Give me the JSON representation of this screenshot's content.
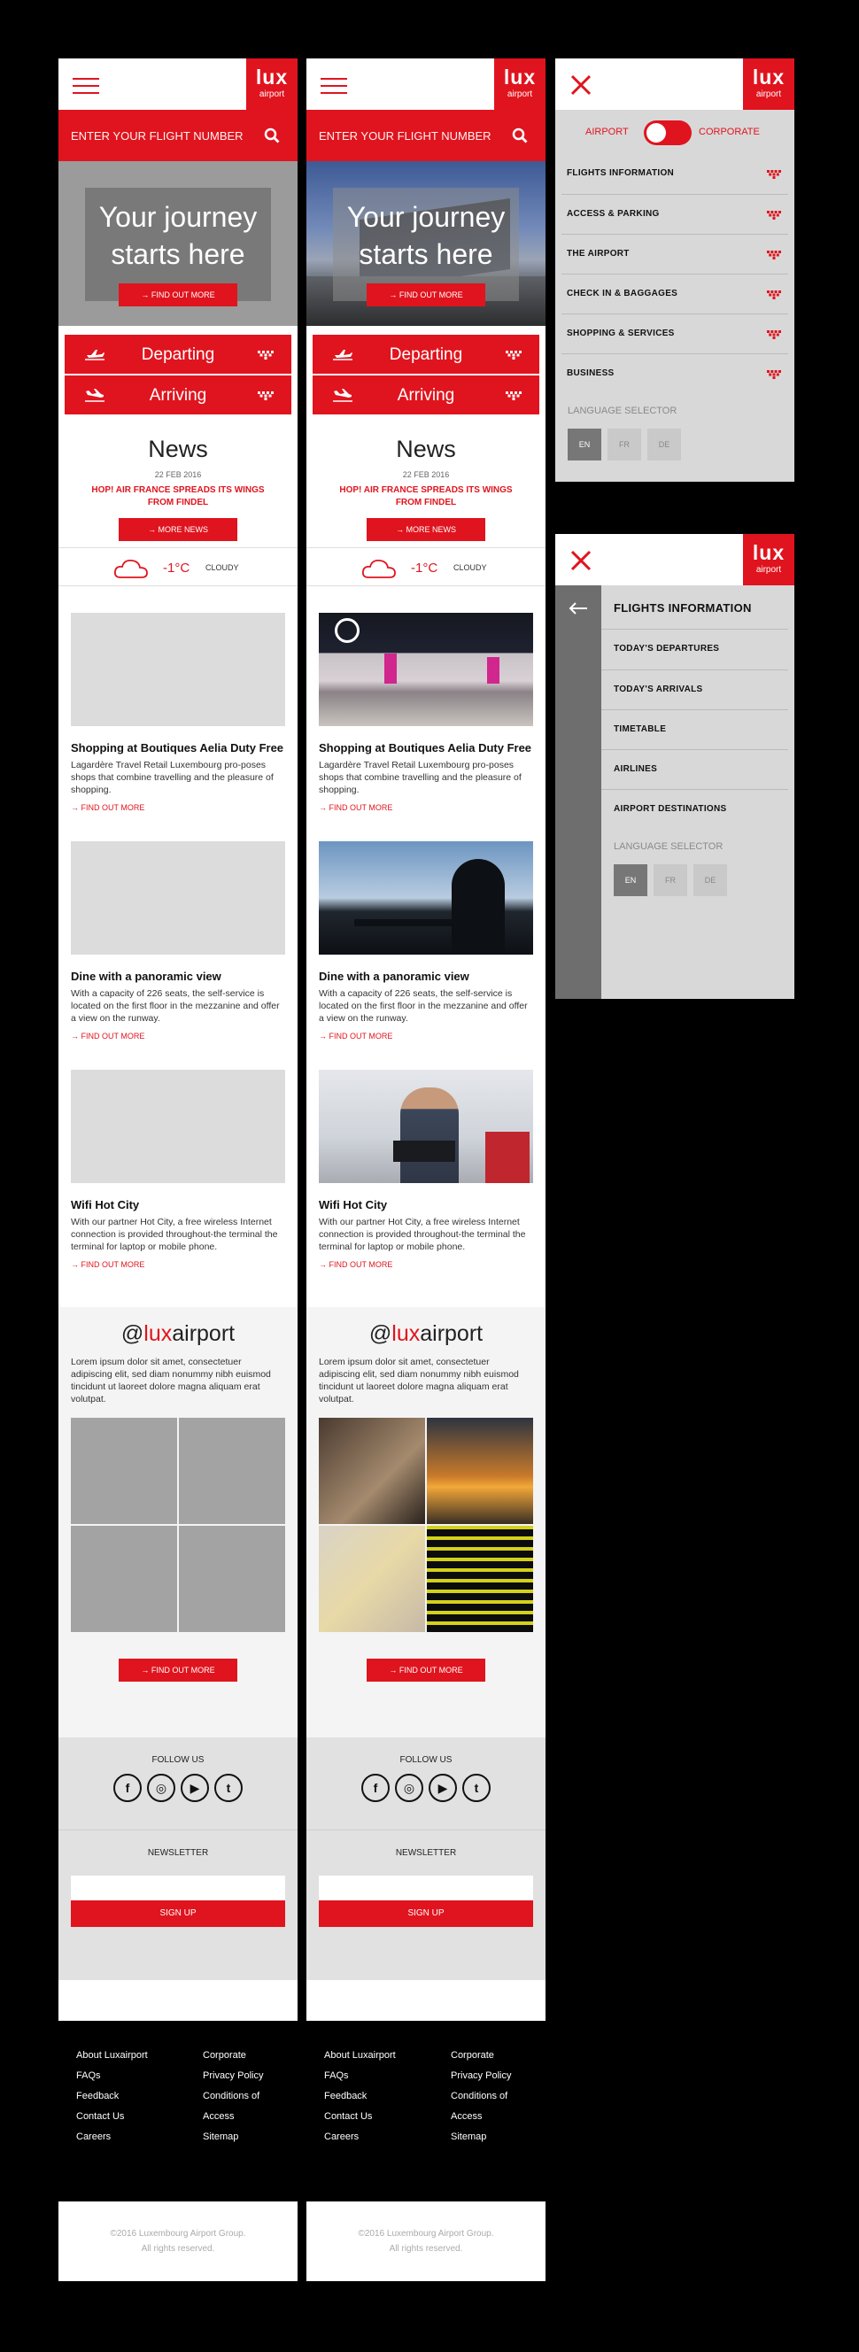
{
  "brand": {
    "logo_text": "lux",
    "logo_sub": "airport",
    "accent": "#e0141e"
  },
  "search": {
    "placeholder": "ENTER YOUR FLIGHT NUMBER"
  },
  "hero": {
    "title": "Your journey starts here",
    "button": "→ FIND OUT MORE"
  },
  "flights": {
    "departing": "Departing",
    "arriving": "Arriving"
  },
  "news": {
    "title": "News",
    "date": "22 FEB 2016",
    "headline": "HOP! AIR FRANCE SPREADS ITS WINGS FROM FINDEL",
    "button": "→ MORE NEWS"
  },
  "weather": {
    "temp": "-1°C",
    "condition": "CLOUDY"
  },
  "cards": [
    {
      "title": "Shopping at Boutiques Aelia Duty Free",
      "text": "Lagardère Travel Retail Luxembourg pro-poses shops that combine travelling and the pleasure of shopping.",
      "link": "→ FIND OUT MORE"
    },
    {
      "title": "Dine with a panoramic view",
      "text": "With a capacity of 226 seats, the self-service is located on the first floor in the mezzanine and offer a view on the runway.",
      "link": "→ FIND OUT MORE"
    },
    {
      "title": "Wifi Hot City",
      "text": "With our partner Hot City, a free wireless Internet connection is provided throughout-the terminal the terminal for laptop or mobile phone.",
      "link": "→ FIND OUT MORE"
    }
  ],
  "social": {
    "handle_at": "@",
    "handle_red": "lux",
    "handle_rest": "airport",
    "text": "Lorem ipsum dolor sit amet, consectetuer adipiscing elit, sed diam nonummy nibh euismod tincidunt ut laoreet dolore magna aliquam erat volutpat.",
    "button": "→ FIND OUT MORE"
  },
  "follow": {
    "title": "FOLLOW US",
    "icons": [
      "f",
      "◎",
      "▶",
      "t"
    ]
  },
  "newsletter": {
    "title": "NEWSLETTER",
    "button": "SIGN UP"
  },
  "footer": {
    "col1": [
      "About Luxairport",
      "FAQs",
      "Feedback",
      "Contact Us",
      "Careers"
    ],
    "col2": [
      "Corporate",
      "Privacy Policy",
      "Conditions of",
      "Access",
      "Sitemap"
    ],
    "copyright1": "©2016 Luxembourg Airport Group.",
    "copyright2": "All rights reserved."
  },
  "menu": {
    "toggle_left": "AIRPORT",
    "toggle_right": "CORPORATE",
    "items": [
      "FLIGHTS INFORMATION",
      "ACCESS & PARKING",
      "THE AIRPORT",
      "CHECK IN & BAGGAGES",
      "SHOPPING & SERVICES",
      "BUSINESS"
    ],
    "lang_label": "LANGUAGE SELECTOR",
    "langs": [
      "EN",
      "FR",
      "DE"
    ]
  },
  "submenu": {
    "title": "FLIGHTS INFORMATION",
    "items": [
      "TODAY'S DEPARTURES",
      "TODAY'S ARRIVALS",
      "TIMETABLE",
      "AIRLINES",
      "AIRPORT DESTINATIONS"
    ]
  }
}
